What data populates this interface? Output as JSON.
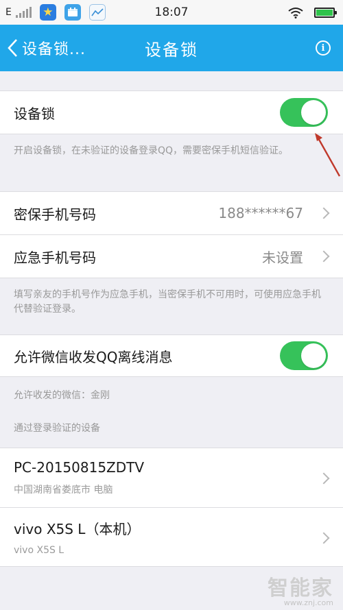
{
  "status_bar": {
    "network": "E",
    "time": "18:07",
    "icons": [
      "signal-icon",
      "star-app-icon",
      "calendar-app-icon",
      "chart-app-icon",
      "wifi-icon",
      "battery-icon"
    ]
  },
  "nav": {
    "back_label": "设备锁...",
    "title": "设备锁",
    "info_glyph": "i"
  },
  "device_lock": {
    "label": "设备锁",
    "enabled": true,
    "hint": "开启设备锁，在未验证的设备登录QQ，需要密保手机短信验证。"
  },
  "phones": {
    "secure_phone_label": "密保手机号码",
    "secure_phone_value": "188******67",
    "emergency_phone_label": "应急手机号码",
    "emergency_phone_value": "未设置",
    "hint": "填写亲友的手机号作为应急手机，当密保手机不可用时，可使用应急手机代替验证登录。"
  },
  "wechat": {
    "label": "允许微信收发QQ离线消息",
    "enabled": true,
    "allowed_wechat": "允许收发的微信：金刚"
  },
  "devices": {
    "section_title": "通过登录验证的设备",
    "items": [
      {
        "name": "PC-20150815ZDTV",
        "detail": "中国湖南省娄底市 电脑"
      },
      {
        "name": "vivo X5S L（本机）",
        "detail": "vivo X5S L"
      }
    ]
  },
  "watermark": {
    "text": "智能家",
    "url": "www.znj.com"
  },
  "colors": {
    "nav_bg": "#20a7e9",
    "toggle_on": "#36c25a",
    "page_bg": "#efeff4",
    "annotation_arrow": "#c0392b"
  }
}
